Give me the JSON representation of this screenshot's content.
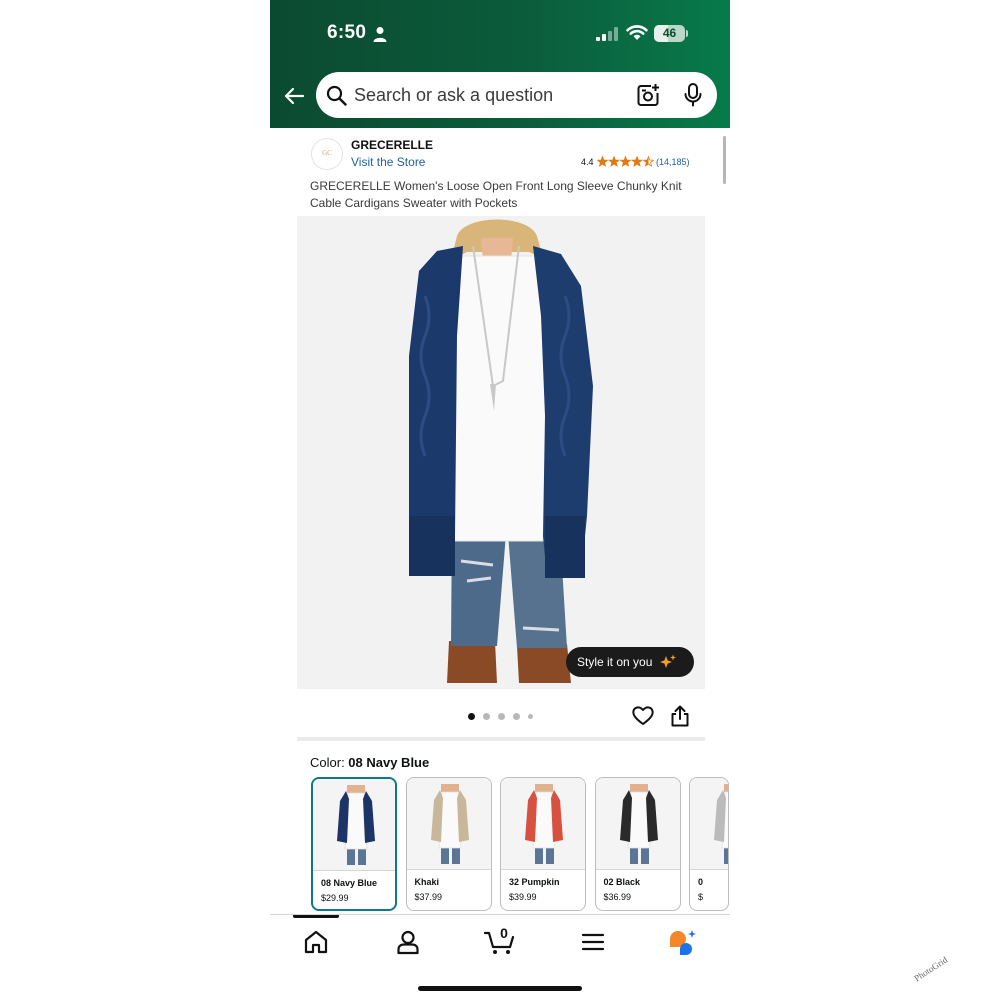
{
  "status_bar": {
    "time": "6:50",
    "battery": "46",
    "battery_level": 0.46
  },
  "search": {
    "placeholder": "Search or ask a question"
  },
  "brand": {
    "logo_text": "GC",
    "name": "GRECERELLE",
    "visit_store": "Visit the Store",
    "rating": "4.4",
    "rating_value": 4.4,
    "review_count": "(14,185)"
  },
  "product": {
    "title": "GRECERELLE Women's Loose Open Front Long Sleeve Chunky Knit Cable Cardigans Sweater with Pockets",
    "style_button": "Style it on you",
    "image_count": 5,
    "current_image": 1
  },
  "color": {
    "label": "Color: ",
    "selected": "08 Navy Blue",
    "options": [
      {
        "name": "08 Navy Blue",
        "price": "$29.99",
        "color": "#1c3566"
      },
      {
        "name": "Khaki",
        "price": "$37.99",
        "color": "#c9b79c"
      },
      {
        "name": "32 Pumpkin",
        "price": "$39.99",
        "color": "#d8503f"
      },
      {
        "name": "02 Black",
        "price": "$36.99",
        "color": "#2a2a2a"
      },
      {
        "name": "0",
        "price": "$",
        "color": "#bbbbbb"
      }
    ]
  },
  "nav": {
    "cart_count": "0"
  },
  "colors": {
    "header_start": "#0b4a31",
    "header_end": "#087a4a",
    "link": "#2162a1",
    "star": "#e47911",
    "selected_border": "#0c7a88"
  },
  "watermark": "PhotoGrid",
  "icons": [
    "person-icon",
    "signal-icon",
    "wifi-icon",
    "back-arrow-icon",
    "search-icon",
    "camera-icon",
    "mic-icon",
    "star-icon",
    "sparkle-icon",
    "heart-icon",
    "share-icon",
    "home-icon",
    "account-icon",
    "cart-icon",
    "menu-icon",
    "rufus-icon"
  ]
}
